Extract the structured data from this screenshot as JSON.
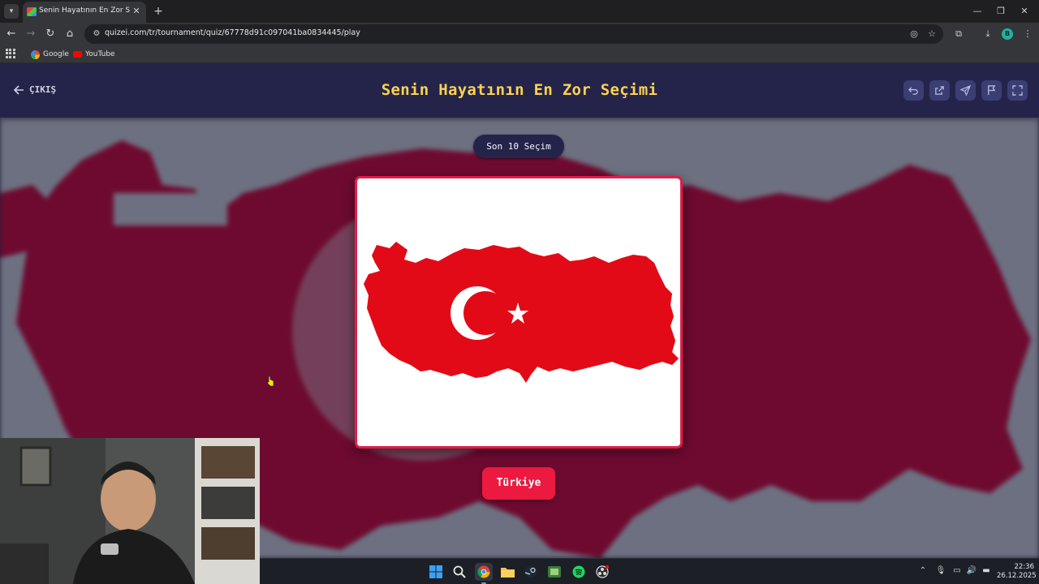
{
  "browser": {
    "tab_title": "Senin Hayatının En Zor Seçimi",
    "url": "quizei.com/tr/tournament/quiz/67778d91c097041ba0834445/play",
    "profile_initial": "B",
    "bookmarks": [
      {
        "label": "Google",
        "icon": "google-icon"
      },
      {
        "label": "YouTube",
        "icon": "youtube-icon"
      }
    ]
  },
  "header": {
    "exit_label": "ÇIKIŞ",
    "title": "Senin Hayatının En Zor Seçimi",
    "actions": [
      "undo-icon",
      "share-icon",
      "send-icon",
      "flag-icon",
      "fullscreen-icon"
    ]
  },
  "game": {
    "round_label": "Son 10 Seçim",
    "choice_label": "Türkiye",
    "choice_image": "turkey-flag-map"
  },
  "colors": {
    "accent": "#fcd34d",
    "brand_red": "#e11d48",
    "header_bg": "#24244a",
    "flag_red": "#e30a17"
  },
  "taskbar": {
    "time": "22:36",
    "date": "26.12.2025",
    "apps": [
      "windows-start-icon",
      "search-icon",
      "chrome-icon",
      "file-explorer-icon",
      "steam-icon",
      "app-icon",
      "spotify-icon",
      "obs-icon"
    ]
  }
}
